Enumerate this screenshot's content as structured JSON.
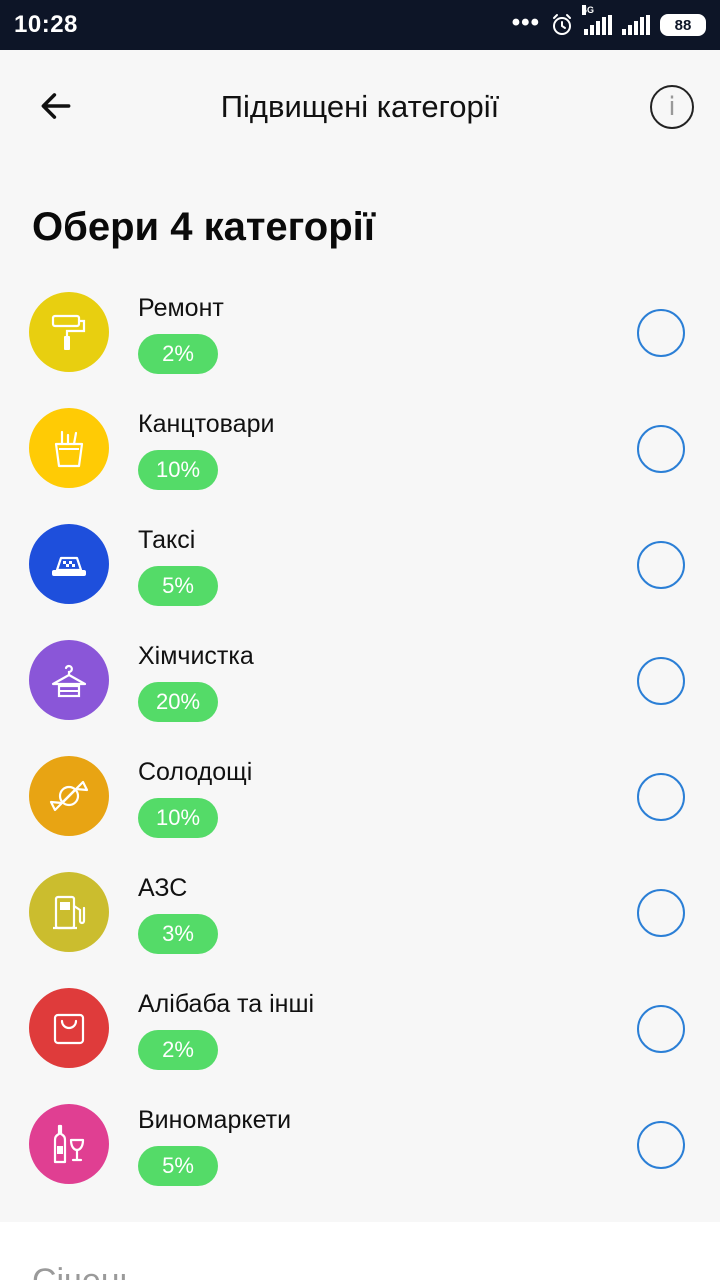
{
  "status_bar": {
    "time": "10:28",
    "network": "4G",
    "battery": "88",
    "icons": [
      "more-dots-icon",
      "alarm-icon",
      "signal-4g-icon",
      "signal-icon",
      "battery-icon"
    ]
  },
  "header": {
    "title": "Підвищені категорії",
    "back_icon": "arrow-left-icon",
    "info_label": "i"
  },
  "section_title": "Обери 4 категорії",
  "colors": {
    "radio_border": "#2b7fd6",
    "badge": "#54db68"
  },
  "categories": [
    {
      "name": "Ремонт",
      "percent": "2%",
      "icon": "paint-roller-icon",
      "color": "#e8cf10"
    },
    {
      "name": "Канцтовари",
      "percent": "10%",
      "icon": "stationery-icon",
      "color": "#ffcb05"
    },
    {
      "name": "Таксі",
      "percent": "5%",
      "icon": "taxi-icon",
      "color": "#1e4fdc"
    },
    {
      "name": "Хімчистка",
      "percent": "20%",
      "icon": "hanger-icon",
      "color": "#8a56d8"
    },
    {
      "name": "Солодощі",
      "percent": "10%",
      "icon": "candy-icon",
      "color": "#e8a413"
    },
    {
      "name": "АЗС",
      "percent": "3%",
      "icon": "fuel-pump-icon",
      "color": "#cbbd2e"
    },
    {
      "name": "Алібаба та інші",
      "percent": "2%",
      "icon": "shopping-bag-icon",
      "color": "#df3b3b"
    },
    {
      "name": "Виномаркети",
      "percent": "5%",
      "icon": "wine-icon",
      "color": "#e03f92"
    }
  ],
  "bottom": {
    "month_label": "Січень"
  }
}
